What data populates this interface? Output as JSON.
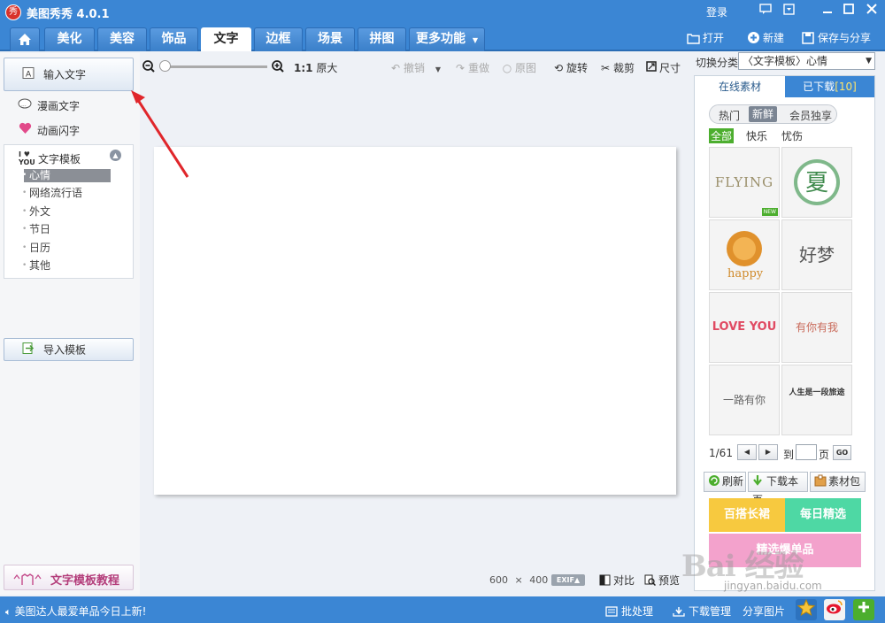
{
  "titlebar": {
    "app_icon_text": "秀",
    "title": "美图秀秀 4.0.1",
    "login": "登录",
    "icons": [
      "message-icon",
      "skin-icon",
      "minimize-icon",
      "maximize-icon",
      "close-icon"
    ]
  },
  "nav": {
    "tabs": [
      "美化",
      "美容",
      "饰品",
      "文字",
      "边框",
      "场景",
      "拼图"
    ],
    "active_tab": "文字",
    "more": "更多功能",
    "open": "打开",
    "new": "新建",
    "save_share": "保存与分享"
  },
  "left": {
    "input_text": "输入文字",
    "comic_text": "漫画文字",
    "anim_text": "动画闪字",
    "template_head": "文字模板",
    "template_icon_text": "I ♥ YOU",
    "template_items": [
      "心情",
      "网络流行语",
      "外文",
      "节日",
      "日历",
      "其他"
    ],
    "selected_item": "心情",
    "import_template": "导入模板",
    "tutorial": "文字模板教程"
  },
  "toolbar": {
    "ratio_label": "1:1",
    "original_size": "原大",
    "undo": "撤销",
    "redo": "重做",
    "original": "原图",
    "rotate": "旋转",
    "crop": "裁剪",
    "size": "尺寸"
  },
  "canvas_info": {
    "width": "600",
    "times": "×",
    "height": "400",
    "exif": "EXIF▲",
    "compare": "对比",
    "preview": "预览"
  },
  "right": {
    "switch_label": "切换分类",
    "category_value": "〈文字模板〉心情",
    "tab_online": "已下载",
    "tab_online_label": "在线素材",
    "tab_downloaded": "已下载",
    "downloaded_count": "[10]",
    "filters": [
      "热门",
      "新鲜",
      "会员独享"
    ],
    "active_filter": "新鲜",
    "categories": [
      "全部",
      "快乐",
      "忧伤"
    ],
    "active_category": "全部",
    "thumbnails": [
      "FLYING",
      "夏",
      "happy",
      "好梦",
      "LOVE YOU",
      "有你有我",
      "一路有你",
      "人生是一段旅途"
    ],
    "new_badge": "NEW",
    "page_info": "1/61",
    "goto_label": "到",
    "page_label": "页",
    "go": "GO",
    "refresh": "刷新",
    "download_page": "下载本页",
    "material_pack": "素材包",
    "banner1": "百搭长裙",
    "banner2": "每日精选",
    "banner3": "精选爆单品",
    "accent": "#3b86d4"
  },
  "status": {
    "message": "美图达人最爱单品今日上新!",
    "batch": "批处理",
    "download_mgr": "下载管理",
    "share_pic": "分享图片"
  },
  "watermark": {
    "text": "Bai 经验",
    "url": "jingyan.baidu.com"
  }
}
